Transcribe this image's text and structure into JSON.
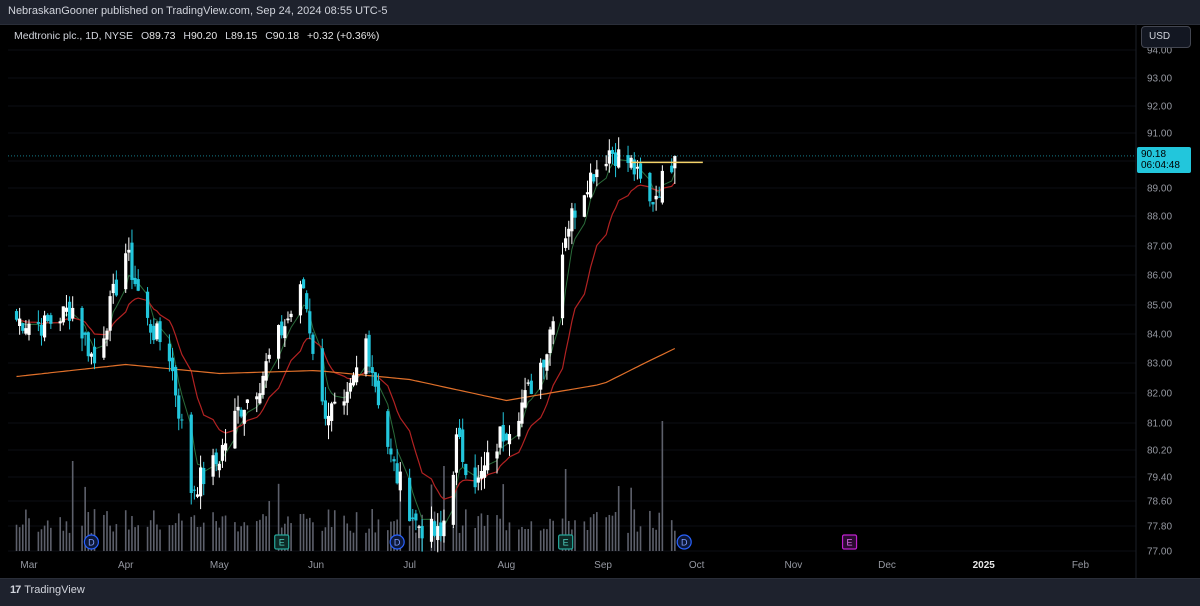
{
  "publisher": "NebraskanGooner published on TradingView.com, Sep 24, 2024 08:55 UTC-5",
  "legend": {
    "symbol": "Medtronic plc., 1D, NYSE",
    "o_label": "O",
    "o": "89.73",
    "h_label": "H",
    "h": "90.20",
    "l_label": "L",
    "l": "89.15",
    "c_label": "C",
    "c": "90.18",
    "change": "+0.32 (+0.36%)"
  },
  "currency_button": "USD",
  "price_tag": {
    "price": "90.18",
    "countdown": "06:04:48"
  },
  "brand": "TradingView",
  "colors": {
    "background": "#000000",
    "bull_candle": "#ffffff",
    "bear_candle": "#22c6dc",
    "ema_fast": "#2a6b3a",
    "ema_mid": "#b22222",
    "sma_slow": "#e0702a",
    "resistance_line": "#f5d36a",
    "event_dividend": "#2962ff",
    "event_split": "#26a69a",
    "event_earnings": "#c020d0"
  },
  "chart_data": {
    "type": "candlestick",
    "title": "Medtronic plc., 1D, NYSE",
    "y_ticks": [
      "94.00",
      "93.00",
      "92.00",
      "91.00",
      "90.00",
      "89.00",
      "88.00",
      "87.00",
      "86.00",
      "85.00",
      "84.00",
      "83.00",
      "82.00",
      "81.00",
      "80.20",
      "79.40",
      "78.60",
      "77.80",
      "77.00"
    ],
    "x_ticks": [
      "Mar",
      "Apr",
      "May",
      "Jun",
      "Jul",
      "Aug",
      "Sep",
      "Oct",
      "Nov",
      "Dec",
      "2025",
      "Feb"
    ],
    "last_price": 90.18,
    "resistance_level": 89.95,
    "anchors": [
      {
        "d": "2024-02-26",
        "p": 84.5
      },
      {
        "d": "2024-03-06",
        "p": 84.3
      },
      {
        "d": "2024-03-15",
        "p": 84.9
      },
      {
        "d": "2024-03-22",
        "p": 83.0
      },
      {
        "d": "2024-04-01",
        "p": 86.8
      },
      {
        "d": "2024-04-08",
        "p": 84.4
      },
      {
        "d": "2024-04-15",
        "p": 83.3
      },
      {
        "d": "2024-04-22",
        "p": 79.0
      },
      {
        "d": "2024-04-30",
        "p": 79.8
      },
      {
        "d": "2024-05-07",
        "p": 81.4
      },
      {
        "d": "2024-05-14",
        "p": 82.4
      },
      {
        "d": "2024-05-20",
        "p": 83.9
      },
      {
        "d": "2024-05-28",
        "p": 85.6
      },
      {
        "d": "2024-06-03",
        "p": 81.5
      },
      {
        "d": "2024-06-10",
        "p": 81.3
      },
      {
        "d": "2024-06-17",
        "p": 83.8
      },
      {
        "d": "2024-06-25",
        "p": 79.9
      },
      {
        "d": "2024-07-03",
        "p": 77.9
      },
      {
        "d": "2024-07-11",
        "p": 77.4
      },
      {
        "d": "2024-07-16",
        "p": 80.4
      },
      {
        "d": "2024-07-23",
        "p": 79.2
      },
      {
        "d": "2024-07-30",
        "p": 80.6
      },
      {
        "d": "2024-08-07",
        "p": 81.8
      },
      {
        "d": "2024-08-14",
        "p": 83.5
      },
      {
        "d": "2024-08-20",
        "p": 87.5
      },
      {
        "d": "2024-08-27",
        "p": 89.3
      },
      {
        "d": "2024-09-03",
        "p": 90.4
      },
      {
        "d": "2024-09-10",
        "p": 89.9
      },
      {
        "d": "2024-09-16",
        "p": 88.4
      },
      {
        "d": "2024-09-24",
        "p": 90.18
      }
    ],
    "sma_slow": [
      {
        "d": "2024-02-26",
        "p": 82.55
      },
      {
        "d": "2024-04-01",
        "p": 82.95
      },
      {
        "d": "2024-05-01",
        "p": 82.65
      },
      {
        "d": "2024-06-01",
        "p": 82.75
      },
      {
        "d": "2024-07-01",
        "p": 82.45
      },
      {
        "d": "2024-08-01",
        "p": 81.75
      },
      {
        "d": "2024-09-01",
        "p": 82.3
      },
      {
        "d": "2024-09-24",
        "p": 83.5
      }
    ],
    "event_markers": [
      {
        "d": "2024-03-21",
        "label": "D",
        "kind": "dividend"
      },
      {
        "d": "2024-05-21",
        "label": "E",
        "kind": "earnings"
      },
      {
        "d": "2024-06-27",
        "label": "D",
        "kind": "dividend"
      },
      {
        "d": "2024-08-20",
        "label": "E",
        "kind": "earnings"
      },
      {
        "d": "2024-09-27",
        "label": "D",
        "kind": "dividend"
      },
      {
        "d": "2024-11-19",
        "label": "E",
        "kind": "earnings_upcoming"
      }
    ]
  }
}
